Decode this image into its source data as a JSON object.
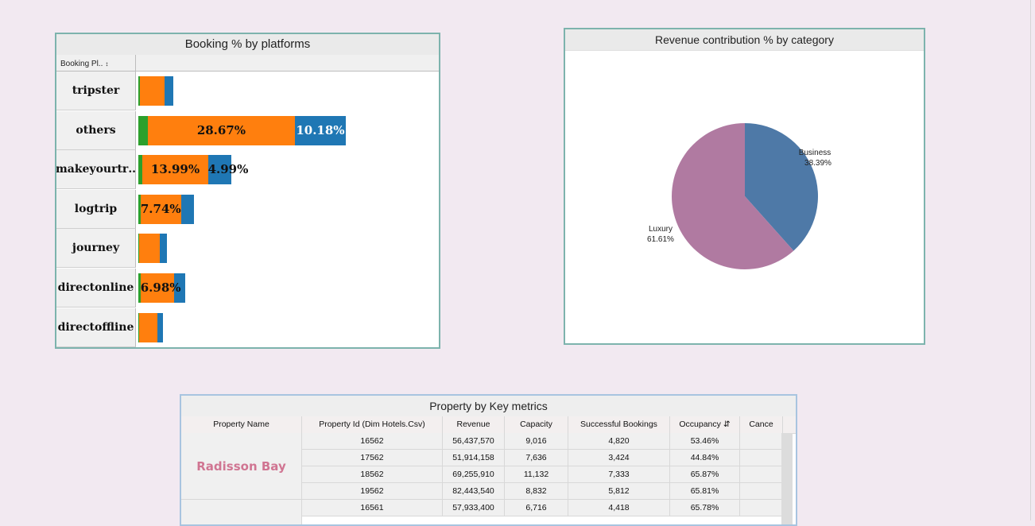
{
  "colors": {
    "background": "#f2e9f1",
    "green": "#2ca02c",
    "orange": "#ff7f0e",
    "blue": "#1f77b4",
    "business": "#4e79a7",
    "luxury": "#b07aa1",
    "property_text": "#d07592"
  },
  "chart_data": [
    {
      "type": "bar",
      "title": "Booking % by platforms",
      "orientation": "horizontal",
      "stacked": true,
      "column_header": "Booking Pl..",
      "categories": [
        "tripster",
        "others",
        "makeyourtr..",
        "logtrip",
        "journey",
        "direct online",
        "direct offline"
      ],
      "category_lines": [
        [
          "tripster"
        ],
        [
          "others"
        ],
        [
          "makeyourtr",
          ".."
        ],
        [
          "logtrip"
        ],
        [
          "journey"
        ],
        [
          "direct",
          "online"
        ],
        [
          "direct",
          "offline"
        ]
      ],
      "series": [
        {
          "color": "#2ca02c",
          "values": [
            0.2,
            1.3,
            0.6,
            0.3,
            0.1,
            0.3,
            0.1
          ]
        },
        {
          "color": "#ff7f0e",
          "values": [
            3.4,
            20.3,
            9.0,
            5.6,
            2.9,
            4.6,
            2.5
          ]
        },
        {
          "color": "#1f77b4",
          "values": [
            1.2,
            7.0,
            3.2,
            1.8,
            1.0,
            1.6,
            0.8
          ]
        }
      ],
      "data_labels": [
        {
          "category": "others",
          "series": 1,
          "text": "28.67%",
          "color": "#111111"
        },
        {
          "category": "others",
          "series": 2,
          "text": "10.18%",
          "color": "#ffffff"
        },
        {
          "category": "makeyourtr..",
          "series": 1,
          "text": "13.99%",
          "color": "#111111"
        },
        {
          "category": "makeyourtr..",
          "series": 2,
          "text": "4.99%",
          "color": "#111111"
        },
        {
          "category": "logtrip",
          "series": 1,
          "text": "7.74%",
          "color": "#111111"
        },
        {
          "category": "direct online",
          "series": 1,
          "text": "6.98%",
          "color": "#111111"
        }
      ],
      "xlim": [
        0,
        41
      ],
      "grid": false
    },
    {
      "type": "pie",
      "title": "Revenue contribution % by category",
      "slices": [
        {
          "label": "Business",
          "value": 38.39,
          "text": "38.39%",
          "color": "#4e79a7"
        },
        {
          "label": "Luxury",
          "value": 61.61,
          "text": "61.61%",
          "color": "#b07aa1"
        }
      ]
    },
    {
      "type": "table",
      "title": "Property by Key metrics",
      "columns": [
        "Property Name",
        "Property Id (Dim Hotels.Csv)",
        "Revenue",
        "Capacity",
        "Successful Bookings",
        "Occupancy",
        "Cance"
      ],
      "group": "Radisson Bay",
      "rows": [
        [
          "16562",
          "56,437,570",
          "9,016",
          "4,820",
          "53.46%",
          ""
        ],
        [
          "17562",
          "51,914,158",
          "7,636",
          "3,424",
          "44.84%",
          ""
        ],
        [
          "18562",
          "69,255,910",
          "11,132",
          "7,333",
          "65.87%",
          ""
        ],
        [
          "19562",
          "82,443,540",
          "8,832",
          "5,812",
          "65.81%",
          ""
        ],
        [
          "16561",
          "57,933,400",
          "6,716",
          "4,418",
          "65.78%",
          ""
        ]
      ]
    }
  ]
}
